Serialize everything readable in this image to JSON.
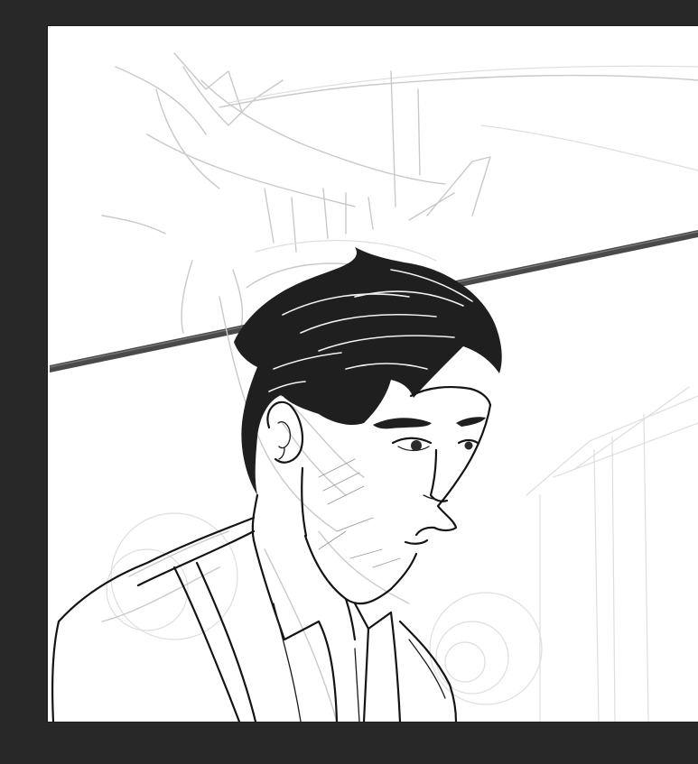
{
  "app": {
    "workspace_color": "#282828",
    "canvas_color": "#ffffff"
  },
  "canvas": {
    "content": "sketch-illustration",
    "subject_icon": "portrait-drawing-icon",
    "ink_color": "#141414",
    "sketch_color": "#c9c9c9",
    "stroke_color": "#555555"
  }
}
